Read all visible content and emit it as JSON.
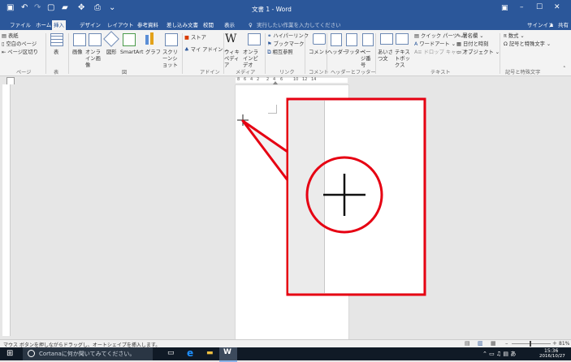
{
  "window": {
    "title": "文書 1 - Word"
  },
  "window_controls": {
    "minimize": "–",
    "maximize": "☐",
    "close": "✕"
  },
  "tabs": [
    "ファイル",
    "ホーム",
    "挿入",
    "デザイン",
    "レイアウト",
    "参考資料",
    "差し込み文書",
    "校閲",
    "表示"
  ],
  "tellme": "実行したい作業を入力してください",
  "signin": "サインイン",
  "share": "共有",
  "ribbon": {
    "pages": {
      "items": [
        "表紙",
        "空白のページ",
        "ページ区切り"
      ],
      "label": "ページ"
    },
    "table": {
      "item": "表",
      "label": "表"
    },
    "illustrations": {
      "items": [
        "画像",
        "オンライン画像",
        "図形",
        "SmartArt",
        "グラフ",
        "スクリーンショット"
      ],
      "label": "図"
    },
    "addins": {
      "items": [
        "ストア",
        "マイ アドイン"
      ],
      "label": "アドイン"
    },
    "media": {
      "items": [
        "ウィキペディア",
        "オンラインビデオ"
      ],
      "label": "メディア"
    },
    "links": {
      "items": [
        "ハイパーリンク",
        "ブックマーク",
        "相互参照"
      ],
      "label": "リンク"
    },
    "comment": {
      "item": "コメント",
      "label": "コメント"
    },
    "headerfooter": {
      "items": [
        "ヘッダー",
        "フッター",
        "ページ番号"
      ],
      "label": "ヘッダーとフッター"
    },
    "text": {
      "items": [
        "あいさつ文",
        "テキストボックス",
        "クイック パーツ",
        "ワードアート",
        "ドロップ キャップ",
        "署名欄",
        "日付と時刻",
        "オブジェクト"
      ],
      "label": "テキスト"
    },
    "symbols": {
      "items": [
        "数式",
        "記号と特殊文字"
      ],
      "label": "記号と特殊文字"
    }
  },
  "ruler_numbers": [
    "8",
    "6",
    "4",
    "2",
    "",
    "2",
    "4",
    "6",
    "",
    "10",
    "12",
    "14"
  ],
  "status": {
    "text": "マウス ボタンを押しながらドラッグし、オートシェイプを挿入します。",
    "zoom": "81%"
  },
  "taskbar": {
    "search": "Cortanaに何か聞いてみてください。",
    "time": "15:36",
    "date": "2016/10/27"
  },
  "colors": {
    "accent": "#2b579a",
    "callout": "#e60012"
  }
}
